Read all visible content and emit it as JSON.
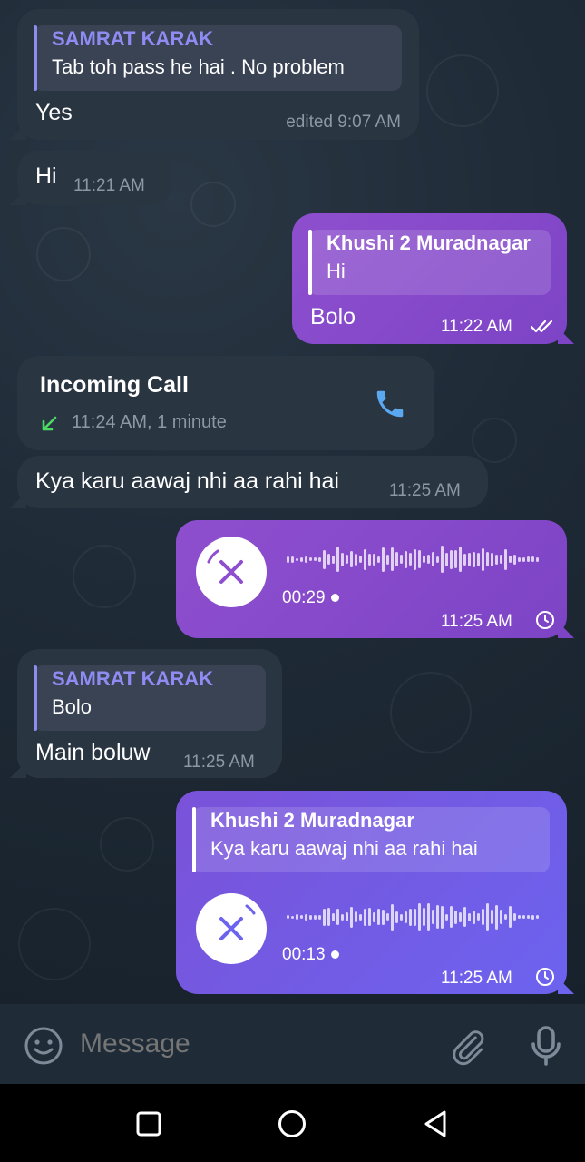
{
  "messages": {
    "m1": {
      "reply_name": "SAMRAT KARAK",
      "reply_text": "Tab toh pass he hai . No problem",
      "text": "Yes",
      "time": "edited 9:07 AM"
    },
    "m2": {
      "text": "Hi",
      "time": "11:21 AM"
    },
    "m3": {
      "reply_name": "Khushi 2 Muradnagar",
      "reply_text": "Hi",
      "text": "Bolo",
      "time": "11:22 AM"
    },
    "m4": {
      "title": "Incoming Call",
      "detail": "11:24 AM, 1 minute"
    },
    "m5": {
      "text": "Kya karu aawaj nhi aa rahi hai",
      "time": "11:25 AM"
    },
    "m6": {
      "duration": "00:29",
      "time": "11:25 AM"
    },
    "m7": {
      "reply_name": "SAMRAT KARAK",
      "reply_text": "Bolo",
      "text": "Main boluw",
      "time": "11:25 AM"
    },
    "m8": {
      "reply_name": "Khushi 2 Muradnagar",
      "reply_text": "Kya karu aawaj nhi aa rahi hai",
      "duration": "00:13",
      "time": "11:25 AM"
    }
  },
  "composer": {
    "placeholder": "Message"
  },
  "icons": {
    "emoji": "smiley-icon",
    "attach": "paperclip-icon",
    "mic": "microphone-icon",
    "call": "phone-icon",
    "missed_arrow": "incoming-arrow-icon",
    "read": "double-check-icon",
    "pending": "clock-icon",
    "cancel": "close-icon",
    "nav": [
      "recent-apps-icon",
      "home-icon",
      "back-icon"
    ]
  },
  "colors": {
    "background": "#17212b",
    "incoming_bubble": "#2a3542",
    "outgoing_bubble": "#8e4fce",
    "outgoing_bubble_alt": "#6c63ef",
    "accent_name": "#8e8cf3",
    "call_icon": "#5aa9f0",
    "call_arrow": "#4cd964"
  }
}
